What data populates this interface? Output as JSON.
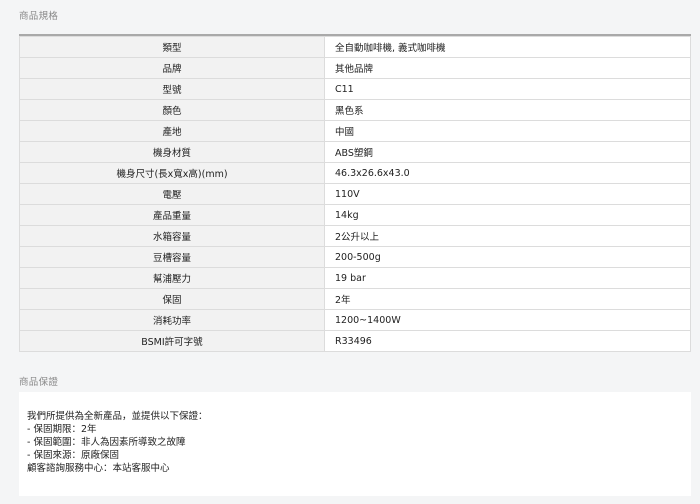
{
  "spec_section": {
    "title": "商品規格",
    "rows": [
      {
        "label": "類型",
        "value": "全自動咖啡機, 義式咖啡機"
      },
      {
        "label": "品牌",
        "value": "其他品牌"
      },
      {
        "label": "型號",
        "value": "C11"
      },
      {
        "label": "顏色",
        "value": "黑色系"
      },
      {
        "label": "產地",
        "value": "中國"
      },
      {
        "label": "機身材質",
        "value": "ABS塑鋼"
      },
      {
        "label": "機身尺寸(長x寬x高)(mm)",
        "value": "46.3x26.6x43.0"
      },
      {
        "label": "電壓",
        "value": "110V"
      },
      {
        "label": "產品重量",
        "value": "14kg"
      },
      {
        "label": "水箱容量",
        "value": "2公升以上"
      },
      {
        "label": "豆槽容量",
        "value": "200-500g"
      },
      {
        "label": "幫浦壓力",
        "value": "19 bar"
      },
      {
        "label": "保固",
        "value": "2年"
      },
      {
        "label": "消耗功率",
        "value": "1200~1400W"
      },
      {
        "label": "BSMI許可字號",
        "value": "R33496"
      }
    ]
  },
  "warranty_section": {
    "title": "商品保證",
    "lines": [
      "我們所提供為全新產品，並提供以下保證：",
      "- 保固期限：2年",
      "- 保固範圍：非人為因素所導致之故障",
      "- 保固來源：原廠保固",
      "顧客諮詢服務中心：本站客服中心"
    ]
  }
}
